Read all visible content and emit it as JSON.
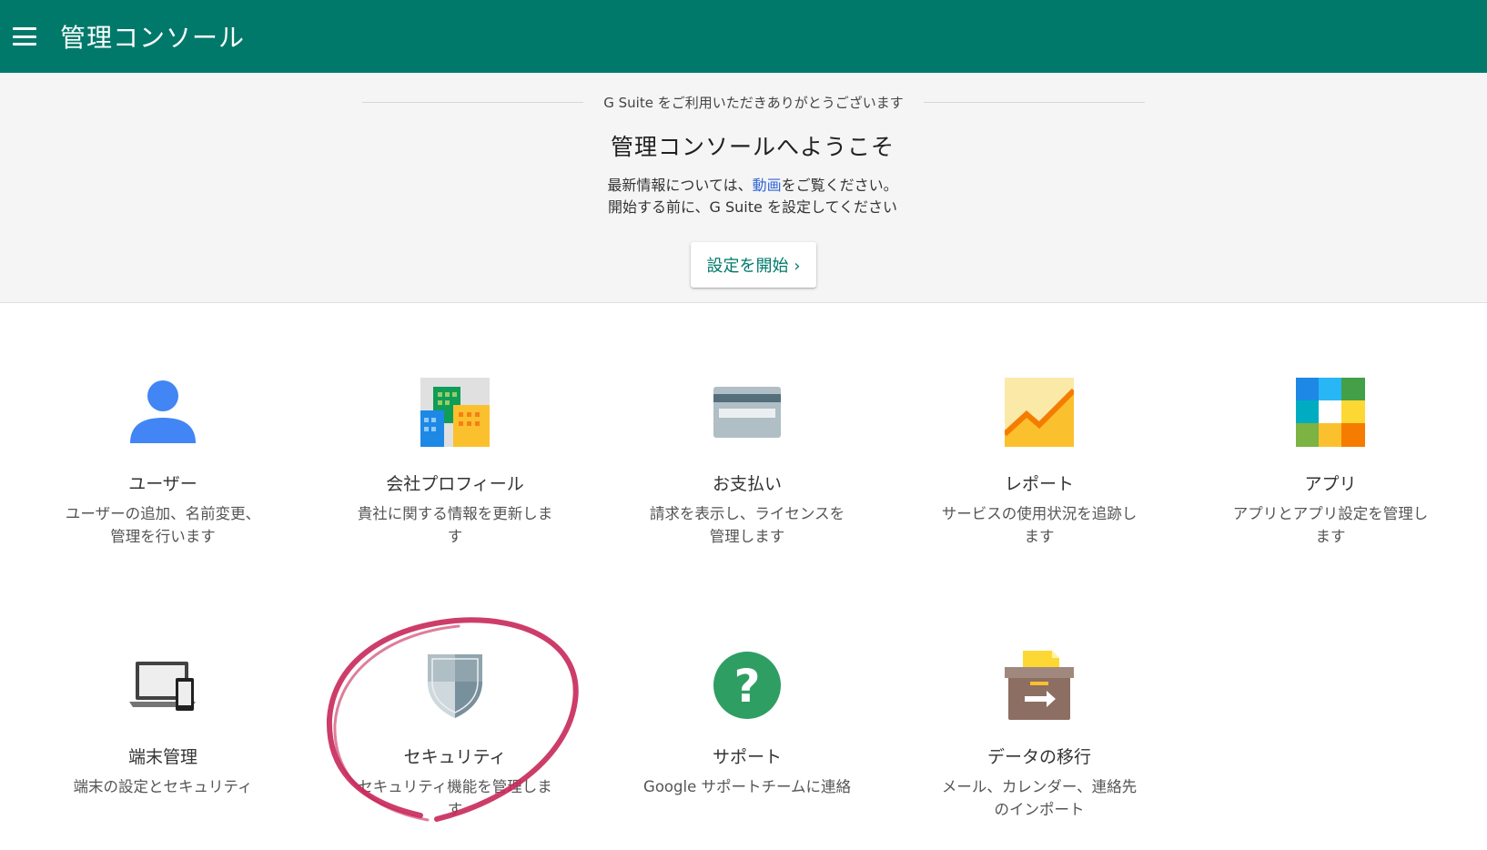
{
  "header": {
    "menu_icon": "hamburger-menu-icon",
    "title": "管理コンソール",
    "color": "#00796b"
  },
  "welcome": {
    "thanks": "G Suite をご利用いただきありがとうございます",
    "title": "管理コンソールへようこそ",
    "desc_prefix": "最新情報については、",
    "desc_link": "動画",
    "desc_suffix": "をご覧ください。",
    "desc_line2": "開始する前に、G Suite を設定してください",
    "setup_button": "設定を開始 ›"
  },
  "tiles": [
    {
      "id": "users",
      "icon": "user-icon",
      "name": "ユーザー",
      "desc": "ユーザーの追加、名前変更、管理を行います"
    },
    {
      "id": "company-profile",
      "icon": "building-icon",
      "name": "会社プロフィール",
      "desc": "貴社に関する情報を更新します"
    },
    {
      "id": "billing",
      "icon": "credit-card-icon",
      "name": "お支払い",
      "desc": "請求を表示し、ライセンスを管理します"
    },
    {
      "id": "reports",
      "icon": "chart-icon",
      "name": "レポート",
      "desc": "サービスの使用状況を追跡します"
    },
    {
      "id": "apps",
      "icon": "apps-grid-icon",
      "name": "アプリ",
      "desc": "アプリとアプリ設定を管理します"
    },
    {
      "id": "devices",
      "icon": "devices-icon",
      "name": "端末管理",
      "desc": "端末の設定とセキュリティ"
    },
    {
      "id": "security",
      "icon": "shield-icon",
      "name": "セキュリティ",
      "desc": "セキュリティ機能を管理します"
    },
    {
      "id": "support",
      "icon": "help-icon",
      "name": "サポート",
      "desc": "Google サポートチームに連絡"
    },
    {
      "id": "data-migration",
      "icon": "migration-box-icon",
      "name": "データの移行",
      "desc": "メール、カレンダー、連絡先のインポート"
    }
  ],
  "annotation": {
    "color": "#c8285a",
    "target": "security"
  }
}
